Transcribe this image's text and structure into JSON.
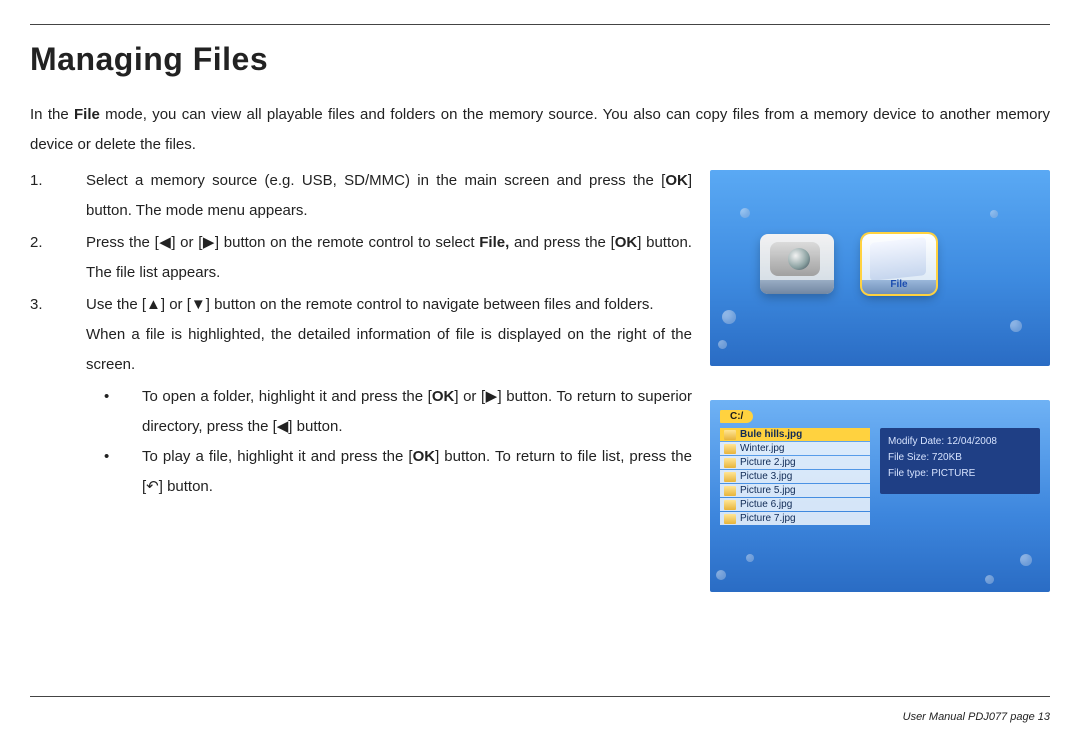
{
  "title": "Managing Files",
  "intro_html": "In the <span class='b'>File</span> mode, you can view all playable files and folders on the memory source. You also can copy files from a memory device to another memory device or delete the files.",
  "steps": [
    {
      "html": "Select a memory source (e.g. USB, SD/MMC) in the main screen and press the [<span class='b'>OK</span>] button. The mode menu appears."
    },
    {
      "html": "Press the [◀] or [▶] button on the remote control to select <span class='b'>File,</span> and press the [<span class='b'>OK</span>] button. The file list appears."
    },
    {
      "html": "Use the [▲] or [▼] button on the remote control to navigate between files and folders.",
      "extra_html": "When a file is highlighted, the detailed information of file is displayed on the right of the screen.",
      "subs": [
        {
          "html": "To open a folder, highlight it and press the [<span class='b'>OK</span>] or [▶] button. To return to superior directory, press the [◀] button."
        },
        {
          "html": "To play a file, highlight it and press the [<span class='b'>OK</span>] button. To return to file list, press the [↶] button."
        }
      ]
    }
  ],
  "shot1": {
    "file_label": "File"
  },
  "shot2": {
    "path": "C:/",
    "files": [
      "Bule hills.jpg",
      "Winter.jpg",
      "Picture 2.jpg",
      "Pictue 3.jpg",
      "Picture 5.jpg",
      "Pictue 6.jpg",
      "Picture 7.jpg"
    ],
    "selected_index": 0,
    "info": {
      "modify_date": "Modify Date: 12/04/2008",
      "file_size": "File Size: 720KB",
      "file_type": "File type: PICTURE"
    }
  },
  "footer": "User Manual PDJ077 page 13"
}
